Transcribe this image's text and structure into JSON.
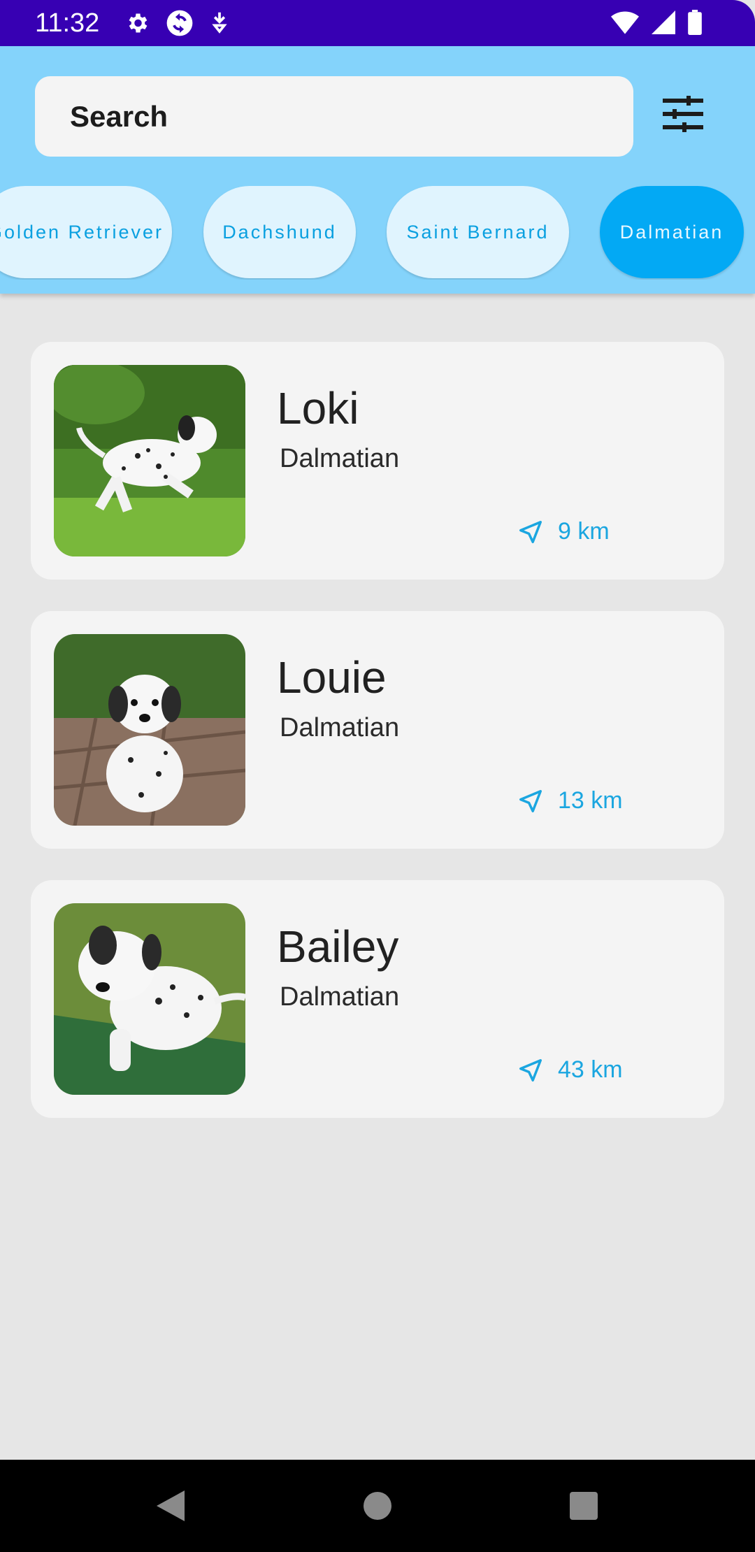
{
  "status_bar": {
    "time": "11:32",
    "icons_left": [
      "gear-icon",
      "sync-icon",
      "download-icon"
    ],
    "icons_right": [
      "wifi-icon",
      "signal-icon",
      "battery-icon"
    ]
  },
  "search": {
    "text": "Search"
  },
  "filter": {
    "icon": "tune-icon"
  },
  "chips": [
    {
      "label": "Golden Retriever",
      "selected": false
    },
    {
      "label": "Dachshund",
      "selected": false
    },
    {
      "label": "Saint Bernard",
      "selected": false
    },
    {
      "label": "Dalmatian",
      "selected": true
    }
  ],
  "dogs": [
    {
      "name": "Loki",
      "breed": "Dalmatian",
      "distance": "9 km"
    },
    {
      "name": "Louie",
      "breed": "Dalmatian",
      "distance": "13 km"
    },
    {
      "name": "Bailey",
      "breed": "Dalmatian",
      "distance": "43 km"
    }
  ],
  "nav": {
    "icons": [
      "back-icon",
      "home-icon",
      "recents-icon"
    ]
  },
  "colors": {
    "status_bar": "#3700b3",
    "header": "#84d3fb",
    "chip_selected": "#03a9f4",
    "chip_text": "#0aa0e0",
    "distance": "#1ba6e0"
  }
}
